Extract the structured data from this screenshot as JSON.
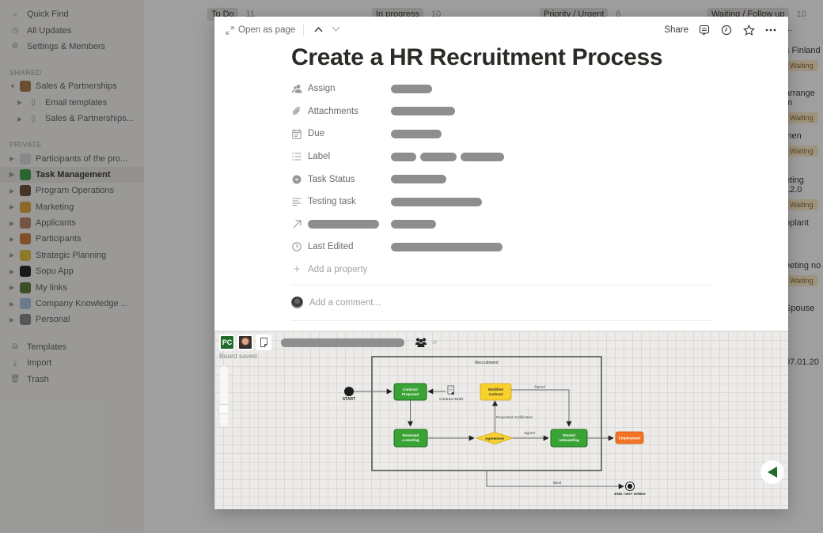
{
  "sidebar": {
    "top_items": [
      {
        "label": "Quick Find",
        "icon": "search-icon"
      },
      {
        "label": "All Updates",
        "icon": "clock-icon"
      },
      {
        "label": "Settings & Members",
        "icon": "gear-icon"
      }
    ],
    "shared_header": "SHARED",
    "shared_items": [
      {
        "label": "Sales & Partnerships",
        "level": 0
      },
      {
        "label": "Email templates",
        "level": 1
      },
      {
        "label": "Sales & Partnerships...",
        "level": 1
      }
    ],
    "private_header": "PRIVATE",
    "private_items": [
      {
        "label": "Participants of the pro...",
        "color": "#d9d9d9"
      },
      {
        "label": "Task Management",
        "color": "#3aa04a",
        "active": true
      },
      {
        "label": "Program Operations",
        "color": "#6b4b3a"
      },
      {
        "label": "Marketing",
        "color": "#e0a53a"
      },
      {
        "label": "Applicants",
        "color": "#b8826a"
      },
      {
        "label": "Participants",
        "color": "#d07a3a"
      },
      {
        "label": "Strategic Planning",
        "color": "#e0c040"
      },
      {
        "label": "Sopu App",
        "color": "#222222"
      },
      {
        "label": "My links",
        "color": "#5a7a3a"
      },
      {
        "label": "Company Knowledge ...",
        "color": "#a9c4e0"
      },
      {
        "label": "Personal",
        "color": "#888888"
      }
    ],
    "bottom_items": [
      {
        "label": "Templates",
        "icon": "templates-icon"
      },
      {
        "label": "Import",
        "icon": "import-icon"
      },
      {
        "label": "Trash",
        "icon": "trash-icon"
      }
    ]
  },
  "board": {
    "columns": [
      {
        "label": "To Do",
        "count": "11"
      },
      {
        "label": "In progress",
        "count": "10"
      },
      {
        "label": "Priority / Urgent",
        "count": "6"
      },
      {
        "label": "Waiting / Follow up",
        "count": "10"
      }
    ],
    "right_cards": [
      {
        "text": "...",
        "badge": ""
      },
      {
        "text": "s Finland",
        "badge": "Waiting"
      },
      {
        "text": "arrange m",
        "badge": "Waiting"
      },
      {
        "text": "inen",
        "badge": "Waiting"
      },
      {
        "text": "eting 12.0",
        "badge": "Waiting"
      },
      {
        "text": "oplant",
        "badge": ""
      },
      {
        "text": "eeting no",
        "badge": "Waiting"
      },
      {
        "text": "Spouse",
        "badge": ""
      },
      {
        "text": "07.01.20",
        "badge": ""
      }
    ]
  },
  "modal": {
    "open_as_page": "Open as page",
    "share": "Share",
    "title": "Create a HR Recruitment Process",
    "properties": [
      {
        "name": "Assign",
        "icon": "people-icon",
        "values": [
          "redacted"
        ]
      },
      {
        "name": "Attachments",
        "icon": "paperclip-icon",
        "values": [
          "redacted"
        ]
      },
      {
        "name": "Due",
        "icon": "calendar-icon",
        "values": [
          "redacted"
        ]
      },
      {
        "name": "Label",
        "icon": "list-icon",
        "values": [
          "redacted",
          "redacted",
          "redacted"
        ]
      },
      {
        "name": "Task Status",
        "icon": "status-icon",
        "values": [
          "redacted"
        ]
      },
      {
        "name": "Testing task",
        "icon": "text-icon",
        "values": [
          "redacted"
        ]
      },
      {
        "name": "",
        "icon": "relation-arrow-icon",
        "values": [
          "redacted"
        ]
      },
      {
        "name": "Last Edited",
        "icon": "clock-icon",
        "values": [
          "redacted"
        ]
      }
    ],
    "add_property": "Add a property",
    "add_comment_placeholder": "Add a comment..."
  },
  "embed": {
    "user_badge": "PC",
    "status": "Board saved",
    "diagram": {
      "container_label": "Recruitment",
      "start_label": "START",
      "nodes": {
        "contract_proposed": "Contract Proposed",
        "reserved_meeting": "Reserved a meeting",
        "modified_contract": "Modified contract",
        "agreement": "Agreement",
        "started_onboarding": "Started onboarding",
        "employment": "Employment",
        "contract_draft": "Contract Draft",
        "end": "END: NOT HIRED"
      },
      "edge_labels": {
        "signed_top": "Signed",
        "requested": "Requested modification",
        "signed_bottom": "Signed",
        "failed": "failed"
      },
      "colors": {
        "green": "#3aa335",
        "green_border": "#1f6e1c",
        "yellow": "#f9d12e",
        "orange": "#f27322",
        "back_arrow": "#1e6b2b"
      }
    }
  }
}
